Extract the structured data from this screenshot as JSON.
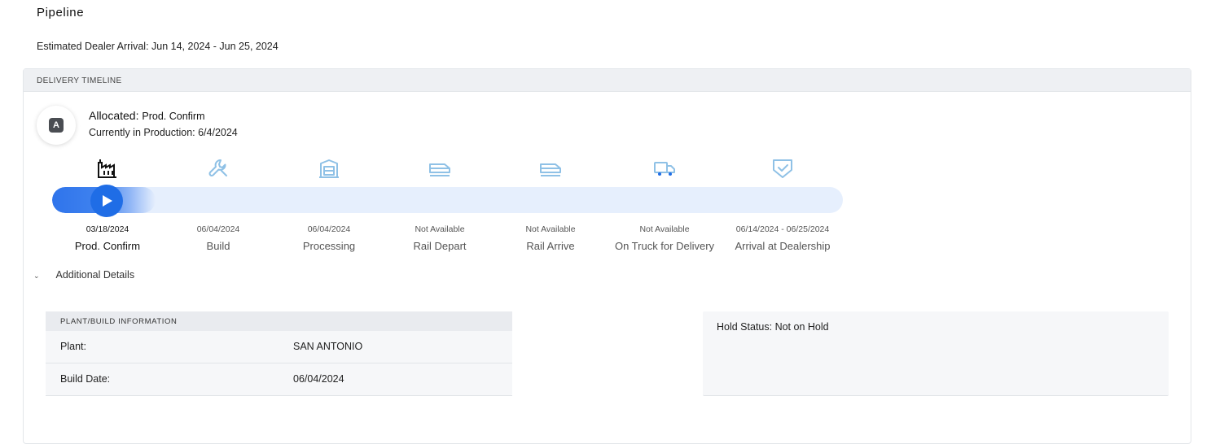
{
  "page": {
    "title": "Pipeline",
    "arrival": "Estimated Dealer Arrival: Jun 14, 2024 - Jun 25, 2024"
  },
  "timeline": {
    "header": "DELIVERY TIMELINE",
    "status_badge": "A",
    "status_label": "Allocated:",
    "status_value": "Prod. Confirm",
    "status_sub": "Currently in Production: 6/4/2024",
    "progress_fraction": 0.09,
    "steps": [
      {
        "icon": "factory-icon",
        "date": "03/18/2024",
        "label": "Prod. Confirm",
        "active": true
      },
      {
        "icon": "wrench-icon",
        "date": "06/04/2024",
        "label": "Build",
        "active": false
      },
      {
        "icon": "processing-icon",
        "date": "06/04/2024",
        "label": "Processing",
        "active": false
      },
      {
        "icon": "rail-icon",
        "date": "Not Available",
        "label": "Rail Depart",
        "active": false
      },
      {
        "icon": "rail-icon",
        "date": "Not Available",
        "label": "Rail Arrive",
        "active": false
      },
      {
        "icon": "truck-icon",
        "date": "Not Available",
        "label": "On Truck for Delivery",
        "active": false
      },
      {
        "icon": "shield-check-icon",
        "date": "06/14/2024 - 06/25/2024",
        "label": "Arrival at Dealership",
        "active": false
      }
    ]
  },
  "details": {
    "toggle_label": "Additional Details",
    "plant": {
      "header": "PLANT/BUILD INFORMATION",
      "rows": [
        {
          "label": "Plant:",
          "value": "SAN ANTONIO"
        },
        {
          "label": "Build Date:",
          "value": "06/04/2024"
        }
      ]
    },
    "hold_status": "Hold Status: Not on Hold"
  },
  "colors": {
    "accent": "#1f6de6",
    "track": "#e6effd",
    "inactive_icon": "#8fc1e6"
  }
}
